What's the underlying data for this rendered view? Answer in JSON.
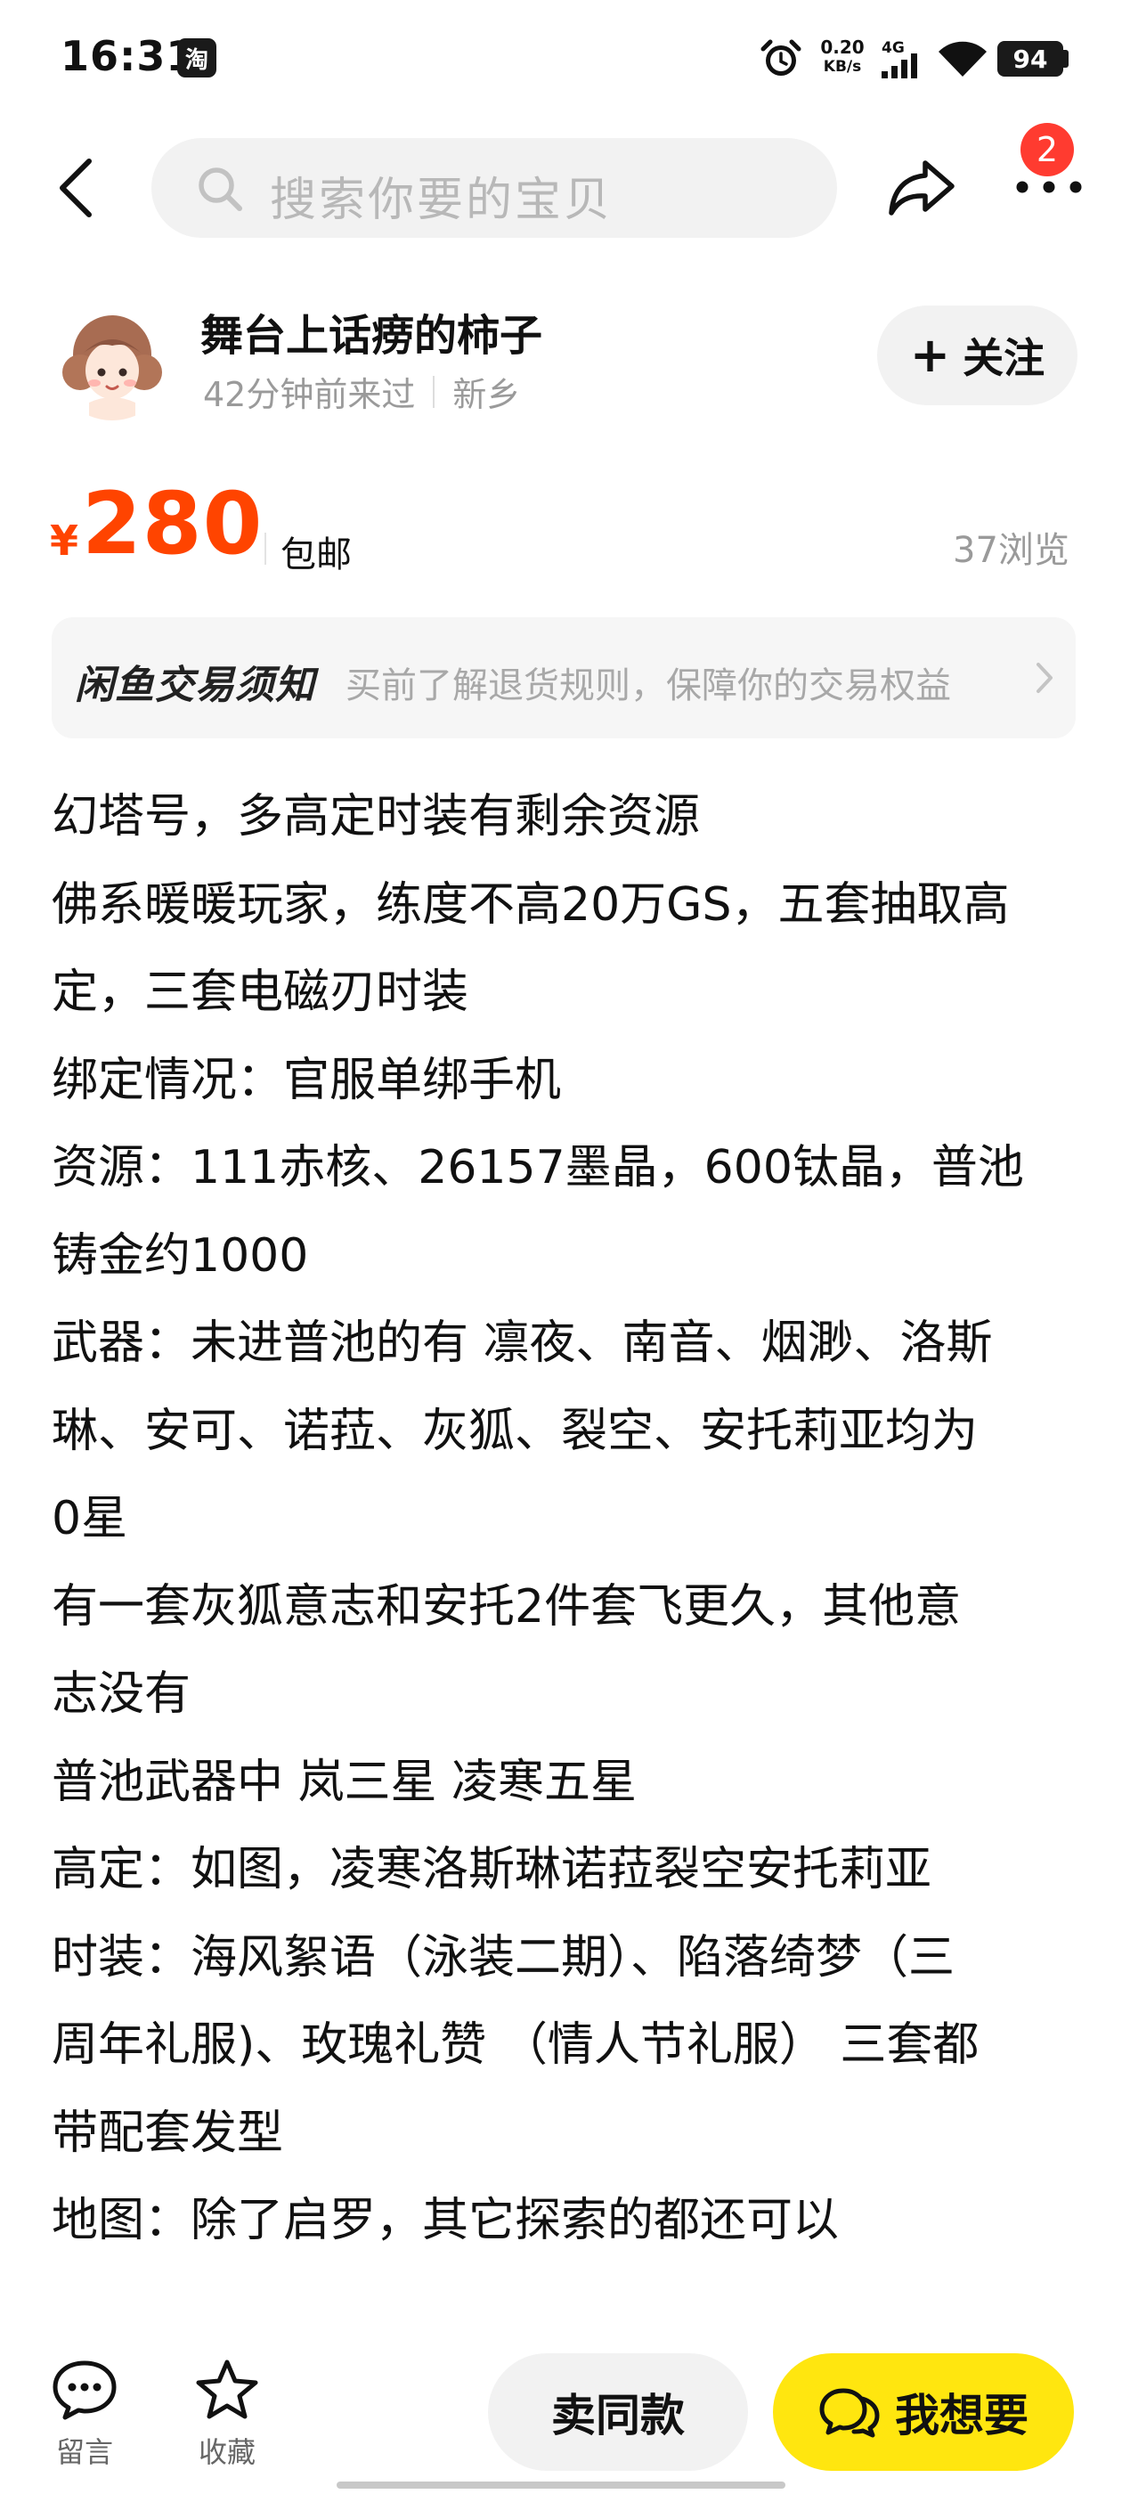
{
  "status_bar": {
    "time": "16:31",
    "app_badge": "淘",
    "net_speed_value": "0.20",
    "net_speed_unit": "KB/s",
    "network_type": "4G",
    "battery": "94"
  },
  "top_nav": {
    "search_placeholder": "搜索你要的宝贝",
    "notification_count": "2"
  },
  "seller": {
    "name": "舞台上话痨的柿子",
    "last_visit": "42分钟前来过",
    "location": "新乡",
    "follow_label": "关注"
  },
  "price": {
    "currency": "¥",
    "value": "280",
    "shipping": "包邮",
    "views": "37浏览"
  },
  "notice": {
    "title": "闲鱼交易须知",
    "text": "买前了解退货规则，保障你的交易权益"
  },
  "description": {
    "lines": [
      "幻塔号，多高定时装有剩余资源",
      "佛系暖暖玩家，练度不高20万GS，五套抽取高",
      "定，三套电磁刃时装",
      "绑定情况：官服单绑手机",
      "资源：111赤核、26157墨晶，600钛晶，普池",
      "铸金约1000",
      "武器：未进普池的有 凛夜、南音、烟渺、洛斯",
      "琳、安可、诺菈、灰狐、裂空、安托莉亚均为",
      "0星",
      "有一套灰狐意志和安托2件套飞更久，其他意",
      "志没有",
      "普池武器中 岚三星 凌寒五星",
      "高定：如图，凌寒洛斯琳诺菈裂空安托莉亚",
      "时装：海风絮语（泳装二期）、陷落绮梦（三",
      "周年礼服)、玫瑰礼赞 （情人节礼服） 三套都",
      "带配套发型",
      "地图：除了启罗，其它探索的都还可以"
    ]
  },
  "bottom_bar": {
    "comment_label": "留言",
    "favorite_label": "收藏",
    "sell_similar_label": "卖同款",
    "want_label": "我想要"
  },
  "colors": {
    "price": "#ff4400",
    "want_button": "#ffe60f",
    "badge": "#ff3b30",
    "search_bg": "#f2f2f2"
  },
  "icons": {
    "back": "back-arrow-icon",
    "search": "search-icon",
    "share": "share-icon",
    "more": "more-dots-icon",
    "comment": "comment-icon",
    "favorite": "star-icon",
    "chat": "chat-bubbles-icon"
  }
}
